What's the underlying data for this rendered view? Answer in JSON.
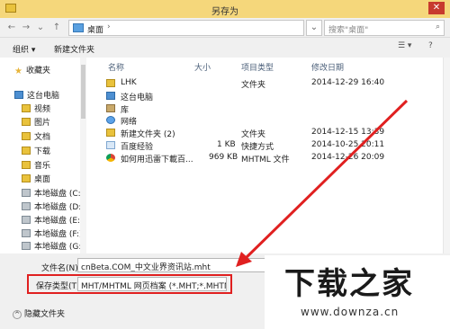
{
  "window": {
    "title": "另存为",
    "close_glyph": "✕"
  },
  "address": {
    "back_glyph": "←",
    "forward_glyph": "→",
    "recent_glyph": "⌄",
    "up_glyph": "↑",
    "crumb": "桌面",
    "crumb_arrow": "›",
    "tools_glyph": "⌄",
    "search_placeholder": "搜索\"桌面\"",
    "search_icon": "magnifier-icon"
  },
  "toolbar": {
    "organize": "组织 ▾",
    "new_folder": "新建文件夹",
    "view_glyph": "☰ ▾",
    "help_glyph": "?"
  },
  "nav": {
    "items": [
      {
        "label": "收藏夹",
        "icon": "star-icon"
      },
      {
        "label": "这台电脑",
        "icon": "computer-icon"
      },
      {
        "label": "视频",
        "icon": "folder-icon"
      },
      {
        "label": "图片",
        "icon": "folder-icon"
      },
      {
        "label": "文档",
        "icon": "folder-icon"
      },
      {
        "label": "下载",
        "icon": "folder-icon"
      },
      {
        "label": "音乐",
        "icon": "music-icon"
      },
      {
        "label": "桌面",
        "icon": "folder-icon"
      },
      {
        "label": "本地磁盘 (C:)",
        "icon": "disk-icon"
      },
      {
        "label": "本地磁盘 (D:)",
        "icon": "disk-icon"
      },
      {
        "label": "本地磁盘 (E:)",
        "icon": "disk-icon"
      },
      {
        "label": "本地磁盘 (F:)",
        "icon": "disk-icon"
      },
      {
        "label": "本地磁盘 (G:)",
        "icon": "disk-icon"
      }
    ]
  },
  "columns": {
    "name": "名称",
    "size": "大小",
    "type": "项目类型",
    "modified": "修改日期"
  },
  "files": [
    {
      "name": "LHK",
      "size": "",
      "type": "文件夹",
      "modified": "2014-12-29 16:40",
      "icon": "folder-icon"
    },
    {
      "name": "这台电脑",
      "size": "",
      "type": "",
      "modified": "",
      "icon": "computer-icon"
    },
    {
      "name": "库",
      "size": "",
      "type": "",
      "modified": "",
      "icon": "library-icon"
    },
    {
      "name": "网络",
      "size": "",
      "type": "",
      "modified": "",
      "icon": "network-icon"
    },
    {
      "name": "新建文件夹 (2)",
      "size": "",
      "type": "文件夹",
      "modified": "2014-12-15 13:39",
      "icon": "folder-icon"
    },
    {
      "name": "百度经验",
      "size": "1 KB",
      "type": "快捷方式",
      "modified": "2014-10-25 20:11",
      "icon": "shortcut-icon"
    },
    {
      "name": "如何用迅雷下載百...",
      "size": "969 KB",
      "type": "MHTML 文件",
      "modified": "2014-12-26 20:09",
      "icon": "chrome-icon"
    }
  ],
  "form": {
    "filename_label": "文件名(N):",
    "filename_value": "cnBeta.COM_中文业界资讯站.mht",
    "filetype_label": "保存类型(T):",
    "filetype_value": "MHT/MHTML 网页档案 (*.MHT;*.MHTML)",
    "hide_folders": "隐藏文件夹"
  },
  "watermark": {
    "title": "下载之家",
    "url": "www.downza.cn"
  },
  "colors": {
    "highlight_frame": "#e02020",
    "arrow": "#e02020"
  }
}
